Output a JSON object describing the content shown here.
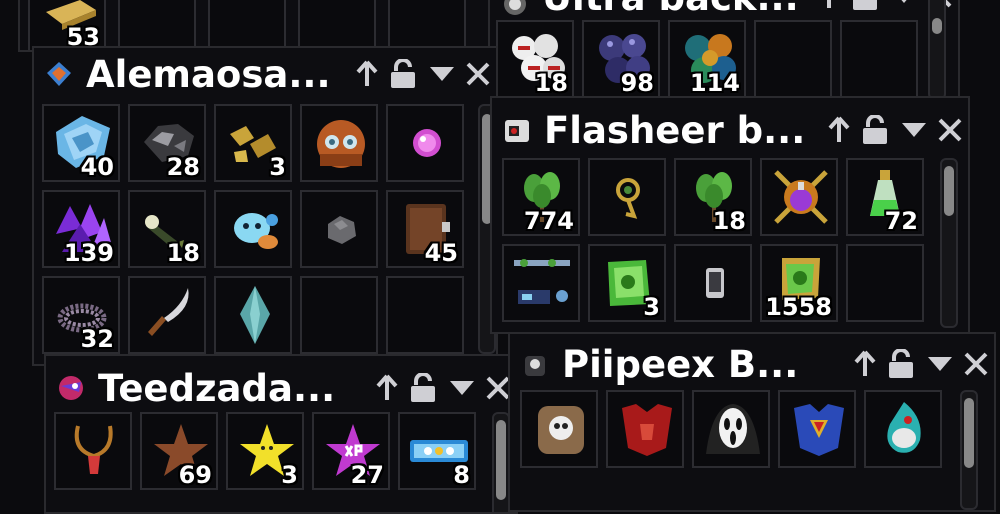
{
  "theme": {
    "panel_bg": "#0d0d11",
    "slot_border": "#2c2c31",
    "text": "#ffffff",
    "scrollbar_thumb": "#888888"
  },
  "panels": {
    "top_left": {
      "items": [
        {
          "icon": "gold-ingot-item-icon",
          "qty": "53"
        },
        {
          "icon": "empty-slot",
          "qty": ""
        },
        {
          "icon": "empty-slot",
          "qty": ""
        },
        {
          "icon": "empty-slot",
          "qty": ""
        },
        {
          "icon": "empty-slot",
          "qty": ""
        }
      ]
    },
    "ultra": {
      "title": "Ultra back...",
      "items": [
        {
          "icon": "white-red-orbs-item-icon",
          "qty": "18"
        },
        {
          "icon": "purple-orbs-item-icon",
          "qty": "98"
        },
        {
          "icon": "multicolor-orbs-item-icon",
          "qty": "114"
        },
        {
          "icon": "empty-slot",
          "qty": ""
        },
        {
          "icon": "empty-slot",
          "qty": ""
        }
      ]
    },
    "alemaosa": {
      "title": "Alemaosa...",
      "items": [
        {
          "icon": "blue-crystal-cluster-item-icon",
          "qty": "40"
        },
        {
          "icon": "dark-ore-item-icon",
          "qty": "28"
        },
        {
          "icon": "gold-nuggets-item-icon",
          "qty": "3"
        },
        {
          "icon": "diving-helmet-item-icon",
          "qty": ""
        },
        {
          "icon": "pink-orb-item-icon",
          "qty": ""
        },
        {
          "icon": "purple-crystals-item-icon",
          "qty": "139"
        },
        {
          "icon": "flashlight-item-icon",
          "qty": "18"
        },
        {
          "icon": "blue-creature-item-icon",
          "qty": ""
        },
        {
          "icon": "grey-stone-item-icon",
          "qty": ""
        },
        {
          "icon": "leather-book-item-icon",
          "qty": "45"
        },
        {
          "icon": "beaded-necklace-item-icon",
          "qty": "32"
        },
        {
          "icon": "curved-dagger-item-icon",
          "qty": ""
        },
        {
          "icon": "teal-crystal-item-icon",
          "qty": ""
        },
        {
          "icon": "empty-slot",
          "qty": ""
        },
        {
          "icon": "empty-slot",
          "qty": ""
        }
      ]
    },
    "flasheer": {
      "title": "Flasheer b...",
      "items": [
        {
          "icon": "green-herb-item-icon",
          "qty": "774"
        },
        {
          "icon": "golden-rune-item-icon",
          "qty": ""
        },
        {
          "icon": "green-herb-item-icon",
          "qty": "18"
        },
        {
          "icon": "potion-emblem-item-icon",
          "qty": ""
        },
        {
          "icon": "green-potion-item-icon",
          "qty": "72"
        },
        {
          "icon": "gadget-set-item-icon",
          "qty": ""
        },
        {
          "icon": "seed-pack-item-icon",
          "qty": "3"
        },
        {
          "icon": "smartphone-item-icon",
          "qty": ""
        },
        {
          "icon": "seed-pack-item-icon",
          "qty": "1558"
        },
        {
          "icon": "empty-slot",
          "qty": ""
        }
      ]
    },
    "teedzada": {
      "title": "Teedzada...",
      "items": [
        {
          "icon": "pendant-item-icon",
          "qty": ""
        },
        {
          "icon": "brown-star-item-icon",
          "qty": "69"
        },
        {
          "icon": "yellow-star-item-icon",
          "qty": "3"
        },
        {
          "icon": "xp-star-item-icon",
          "qty": "27"
        },
        {
          "icon": "pop-ticket-item-icon",
          "qty": "8"
        }
      ]
    },
    "piipeex": {
      "title": "Piipeex B...",
      "items": [
        {
          "icon": "skull-backpack-item-icon",
          "qty": ""
        },
        {
          "icon": "red-armor-item-icon",
          "qty": ""
        },
        {
          "icon": "ghost-mask-item-icon",
          "qty": ""
        },
        {
          "icon": "hero-armor-item-icon",
          "qty": ""
        },
        {
          "icon": "teal-spirit-item-icon",
          "qty": ""
        }
      ]
    }
  }
}
